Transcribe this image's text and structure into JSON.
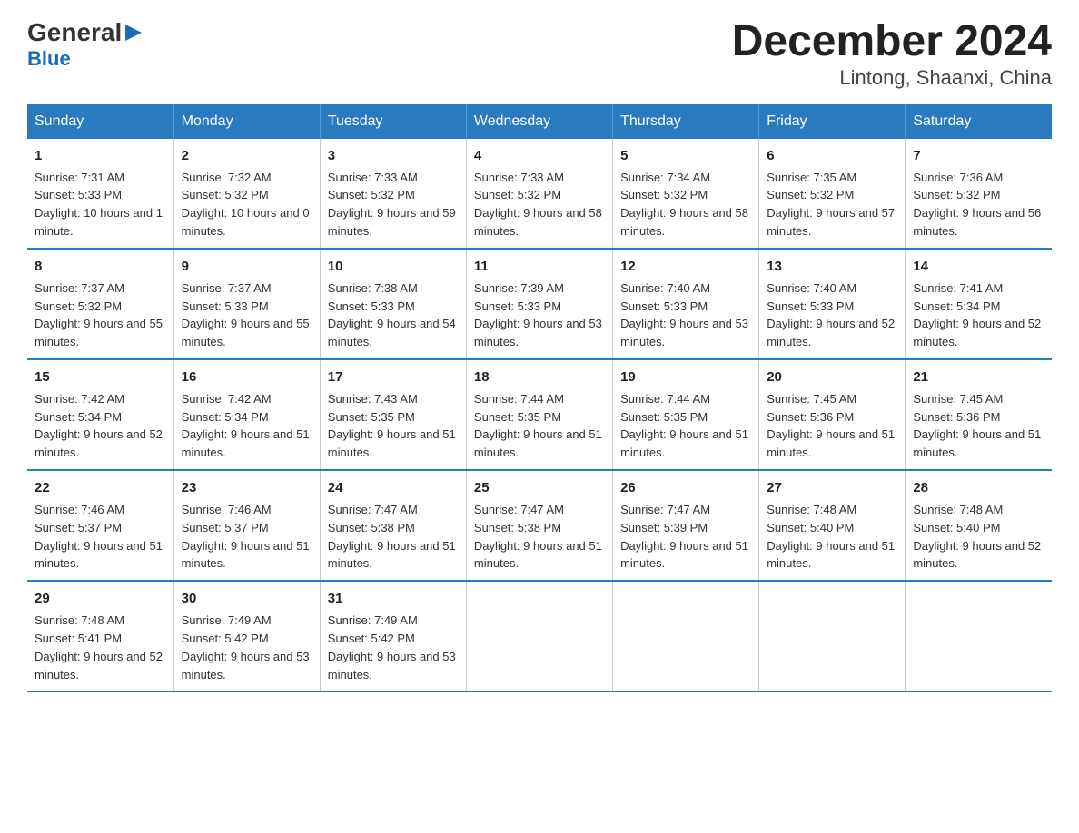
{
  "logo": {
    "general": "General",
    "blue": "Blue",
    "triangle": "▶"
  },
  "title": "December 2024",
  "subtitle": "Lintong, Shaanxi, China",
  "days_of_week": [
    "Sunday",
    "Monday",
    "Tuesday",
    "Wednesday",
    "Thursday",
    "Friday",
    "Saturday"
  ],
  "weeks": [
    [
      {
        "day": "1",
        "sunrise": "7:31 AM",
        "sunset": "5:33 PM",
        "daylight": "10 hours and 1 minute."
      },
      {
        "day": "2",
        "sunrise": "7:32 AM",
        "sunset": "5:32 PM",
        "daylight": "10 hours and 0 minutes."
      },
      {
        "day": "3",
        "sunrise": "7:33 AM",
        "sunset": "5:32 PM",
        "daylight": "9 hours and 59 minutes."
      },
      {
        "day": "4",
        "sunrise": "7:33 AM",
        "sunset": "5:32 PM",
        "daylight": "9 hours and 58 minutes."
      },
      {
        "day": "5",
        "sunrise": "7:34 AM",
        "sunset": "5:32 PM",
        "daylight": "9 hours and 58 minutes."
      },
      {
        "day": "6",
        "sunrise": "7:35 AM",
        "sunset": "5:32 PM",
        "daylight": "9 hours and 57 minutes."
      },
      {
        "day": "7",
        "sunrise": "7:36 AM",
        "sunset": "5:32 PM",
        "daylight": "9 hours and 56 minutes."
      }
    ],
    [
      {
        "day": "8",
        "sunrise": "7:37 AM",
        "sunset": "5:32 PM",
        "daylight": "9 hours and 55 minutes."
      },
      {
        "day": "9",
        "sunrise": "7:37 AM",
        "sunset": "5:33 PM",
        "daylight": "9 hours and 55 minutes."
      },
      {
        "day": "10",
        "sunrise": "7:38 AM",
        "sunset": "5:33 PM",
        "daylight": "9 hours and 54 minutes."
      },
      {
        "day": "11",
        "sunrise": "7:39 AM",
        "sunset": "5:33 PM",
        "daylight": "9 hours and 53 minutes."
      },
      {
        "day": "12",
        "sunrise": "7:40 AM",
        "sunset": "5:33 PM",
        "daylight": "9 hours and 53 minutes."
      },
      {
        "day": "13",
        "sunrise": "7:40 AM",
        "sunset": "5:33 PM",
        "daylight": "9 hours and 52 minutes."
      },
      {
        "day": "14",
        "sunrise": "7:41 AM",
        "sunset": "5:34 PM",
        "daylight": "9 hours and 52 minutes."
      }
    ],
    [
      {
        "day": "15",
        "sunrise": "7:42 AM",
        "sunset": "5:34 PM",
        "daylight": "9 hours and 52 minutes."
      },
      {
        "day": "16",
        "sunrise": "7:42 AM",
        "sunset": "5:34 PM",
        "daylight": "9 hours and 51 minutes."
      },
      {
        "day": "17",
        "sunrise": "7:43 AM",
        "sunset": "5:35 PM",
        "daylight": "9 hours and 51 minutes."
      },
      {
        "day": "18",
        "sunrise": "7:44 AM",
        "sunset": "5:35 PM",
        "daylight": "9 hours and 51 minutes."
      },
      {
        "day": "19",
        "sunrise": "7:44 AM",
        "sunset": "5:35 PM",
        "daylight": "9 hours and 51 minutes."
      },
      {
        "day": "20",
        "sunrise": "7:45 AM",
        "sunset": "5:36 PM",
        "daylight": "9 hours and 51 minutes."
      },
      {
        "day": "21",
        "sunrise": "7:45 AM",
        "sunset": "5:36 PM",
        "daylight": "9 hours and 51 minutes."
      }
    ],
    [
      {
        "day": "22",
        "sunrise": "7:46 AM",
        "sunset": "5:37 PM",
        "daylight": "9 hours and 51 minutes."
      },
      {
        "day": "23",
        "sunrise": "7:46 AM",
        "sunset": "5:37 PM",
        "daylight": "9 hours and 51 minutes."
      },
      {
        "day": "24",
        "sunrise": "7:47 AM",
        "sunset": "5:38 PM",
        "daylight": "9 hours and 51 minutes."
      },
      {
        "day": "25",
        "sunrise": "7:47 AM",
        "sunset": "5:38 PM",
        "daylight": "9 hours and 51 minutes."
      },
      {
        "day": "26",
        "sunrise": "7:47 AM",
        "sunset": "5:39 PM",
        "daylight": "9 hours and 51 minutes."
      },
      {
        "day": "27",
        "sunrise": "7:48 AM",
        "sunset": "5:40 PM",
        "daylight": "9 hours and 51 minutes."
      },
      {
        "day": "28",
        "sunrise": "7:48 AM",
        "sunset": "5:40 PM",
        "daylight": "9 hours and 52 minutes."
      }
    ],
    [
      {
        "day": "29",
        "sunrise": "7:48 AM",
        "sunset": "5:41 PM",
        "daylight": "9 hours and 52 minutes."
      },
      {
        "day": "30",
        "sunrise": "7:49 AM",
        "sunset": "5:42 PM",
        "daylight": "9 hours and 53 minutes."
      },
      {
        "day": "31",
        "sunrise": "7:49 AM",
        "sunset": "5:42 PM",
        "daylight": "9 hours and 53 minutes."
      },
      null,
      null,
      null,
      null
    ]
  ]
}
